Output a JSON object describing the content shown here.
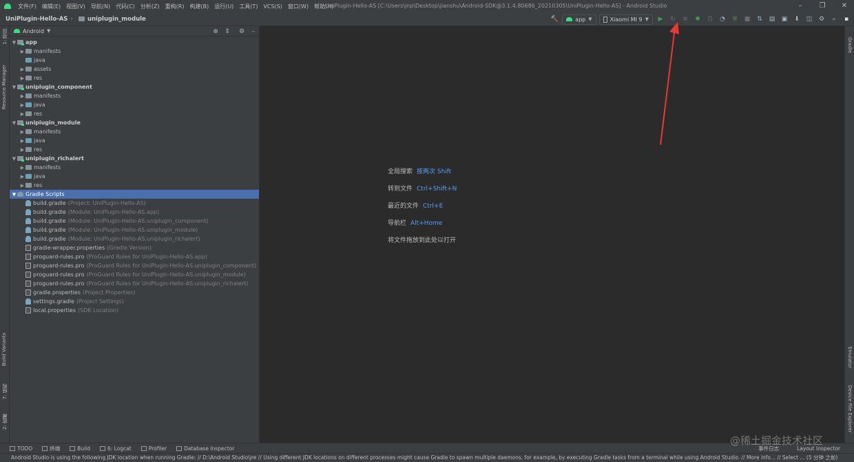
{
  "menu": {
    "items": [
      "文件(F)",
      "编辑(E)",
      "视图(V)",
      "导航(N)",
      "代码(C)",
      "分析(Z)",
      "重构(R)",
      "构建(B)",
      "运行(U)",
      "工具(T)",
      "VCS(S)",
      "窗口(W)",
      "帮助(H)"
    ],
    "window_title": "UniPlugin-Hello-AS [C:\\Users\\jnp\\Desktop\\jianshu\\Android-SDK@3.1.4.80686_20210305\\UniPlugin-Hello-AS] - Android Studio"
  },
  "breadcrumb": {
    "project": "UniPlugin-Hello-AS",
    "module": "uniplugin_module"
  },
  "toolbar": {
    "config": "app",
    "device": "Xiaomi MI 9"
  },
  "left_tabs": {
    "project": "1: 项目",
    "resource_manager": "Resource Manager",
    "build_variants": "Build Variants",
    "structure": "7: 结构",
    "favorites": "2: 收藏"
  },
  "right_tabs": {
    "gradle": "Gradle",
    "emulator": "Emulator",
    "device_file_explorer": "Device File Explorer"
  },
  "project_panel": {
    "view_mode": "Android",
    "tree": [
      {
        "label": "app",
        "type": "module",
        "level": 0,
        "expanded": true,
        "bold": true
      },
      {
        "label": "manifests",
        "type": "folder",
        "level": 1
      },
      {
        "label": "java",
        "type": "folder-blue",
        "level": 1,
        "leaf": true
      },
      {
        "label": "assets",
        "type": "folder",
        "level": 1
      },
      {
        "label": "res",
        "type": "folder",
        "level": 1
      },
      {
        "label": "uniplugin_component",
        "type": "module",
        "level": 0,
        "expanded": true,
        "bold": true
      },
      {
        "label": "manifests",
        "type": "folder",
        "level": 1
      },
      {
        "label": "java",
        "type": "folder-blue",
        "level": 1
      },
      {
        "label": "res",
        "type": "folder",
        "level": 1
      },
      {
        "label": "uniplugin_module",
        "type": "module",
        "level": 0,
        "expanded": true,
        "bold": true
      },
      {
        "label": "manifests",
        "type": "folder",
        "level": 1
      },
      {
        "label": "java",
        "type": "folder-blue",
        "level": 1
      },
      {
        "label": "res",
        "type": "folder",
        "level": 1
      },
      {
        "label": "uniplugin_richalert",
        "type": "module",
        "level": 0,
        "expanded": true,
        "bold": true
      },
      {
        "label": "manifests",
        "type": "folder",
        "level": 1
      },
      {
        "label": "java",
        "type": "folder-blue",
        "level": 1
      },
      {
        "label": "res",
        "type": "folder",
        "level": 1
      },
      {
        "label": "Gradle Scripts",
        "type": "gradle-folder",
        "level": 0,
        "expanded": true,
        "selected": true
      },
      {
        "label": "build.gradle",
        "hint": "(Project: UniPlugin-Hello-AS)",
        "type": "gradle",
        "level": 1,
        "leaf": true
      },
      {
        "label": "build.gradle",
        "hint": "(Module: UniPlugin-Hello-AS.app)",
        "type": "gradle",
        "level": 1,
        "leaf": true
      },
      {
        "label": "build.gradle",
        "hint": "(Module: UniPlugin-Hello-AS.uniplugin_component)",
        "type": "gradle",
        "level": 1,
        "leaf": true
      },
      {
        "label": "build.gradle",
        "hint": "(Module: UniPlugin-Hello-AS.uniplugin_module)",
        "type": "gradle",
        "level": 1,
        "leaf": true
      },
      {
        "label": "build.gradle",
        "hint": "(Module: UniPlugin-Hello-AS.uniplugin_richalert)",
        "type": "gradle",
        "level": 1,
        "leaf": true
      },
      {
        "label": "gradle-wrapper.properties",
        "hint": "(Gradle Version)",
        "type": "prop",
        "level": 1,
        "leaf": true
      },
      {
        "label": "proguard-rules.pro",
        "hint": "(ProGuard Rules for UniPlugin-Hello-AS.app)",
        "type": "prop",
        "level": 1,
        "leaf": true
      },
      {
        "label": "proguard-rules.pro",
        "hint": "(ProGuard Rules for UniPlugin-Hello-AS.uniplugin_component)",
        "type": "prop",
        "level": 1,
        "leaf": true
      },
      {
        "label": "proguard-rules.pro",
        "hint": "(ProGuard Rules for UniPlugin-Hello-AS.uniplugin_module)",
        "type": "prop",
        "level": 1,
        "leaf": true
      },
      {
        "label": "proguard-rules.pro",
        "hint": "(ProGuard Rules for UniPlugin-Hello-AS.uniplugin_richalert)",
        "type": "prop",
        "level": 1,
        "leaf": true
      },
      {
        "label": "gradle.properties",
        "hint": "(Project Properties)",
        "type": "prop",
        "level": 1,
        "leaf": true
      },
      {
        "label": "settings.gradle",
        "hint": "(Project Settings)",
        "type": "gradle",
        "level": 1,
        "leaf": true
      },
      {
        "label": "local.properties",
        "hint": "(SDK Location)",
        "type": "prop",
        "level": 1,
        "leaf": true
      }
    ]
  },
  "editor": {
    "shortcuts": [
      {
        "label": "全局搜索",
        "key": "按两次 Shift"
      },
      {
        "label": "转到文件",
        "key": "Ctrl+Shift+N"
      },
      {
        "label": "最近的文件",
        "key": "Ctrl+E"
      },
      {
        "label": "导航栏",
        "key": "Alt+Home"
      },
      {
        "label": "将文件拖放到此处以打开",
        "key": ""
      }
    ]
  },
  "bottom_tabs": {
    "todo": "TODO",
    "terminal": "终端",
    "build": "Build",
    "logcat": "6: Logcat",
    "profiler": "Profiler",
    "database": "Database Inspector",
    "event_log": "事件日志",
    "layout_inspector": "Layout Inspector"
  },
  "status": {
    "message": "Android Studio is using the following JDK location when running Gradle: // D:\\Android Studio\\jre // Using different JDK locations on different processes might cause Gradle to spawn multiple daemons, for example, by executing Gradle tasks from a terminal while using Android Studio. // More info... // Select ... (5 分钟 之前)"
  },
  "watermark": "@稀土掘金技术社区",
  "colors": {
    "accent_selection": "#4b6eaf",
    "link": "#589df6",
    "run_green": "#499c54",
    "annotation_red": "#e53935"
  }
}
